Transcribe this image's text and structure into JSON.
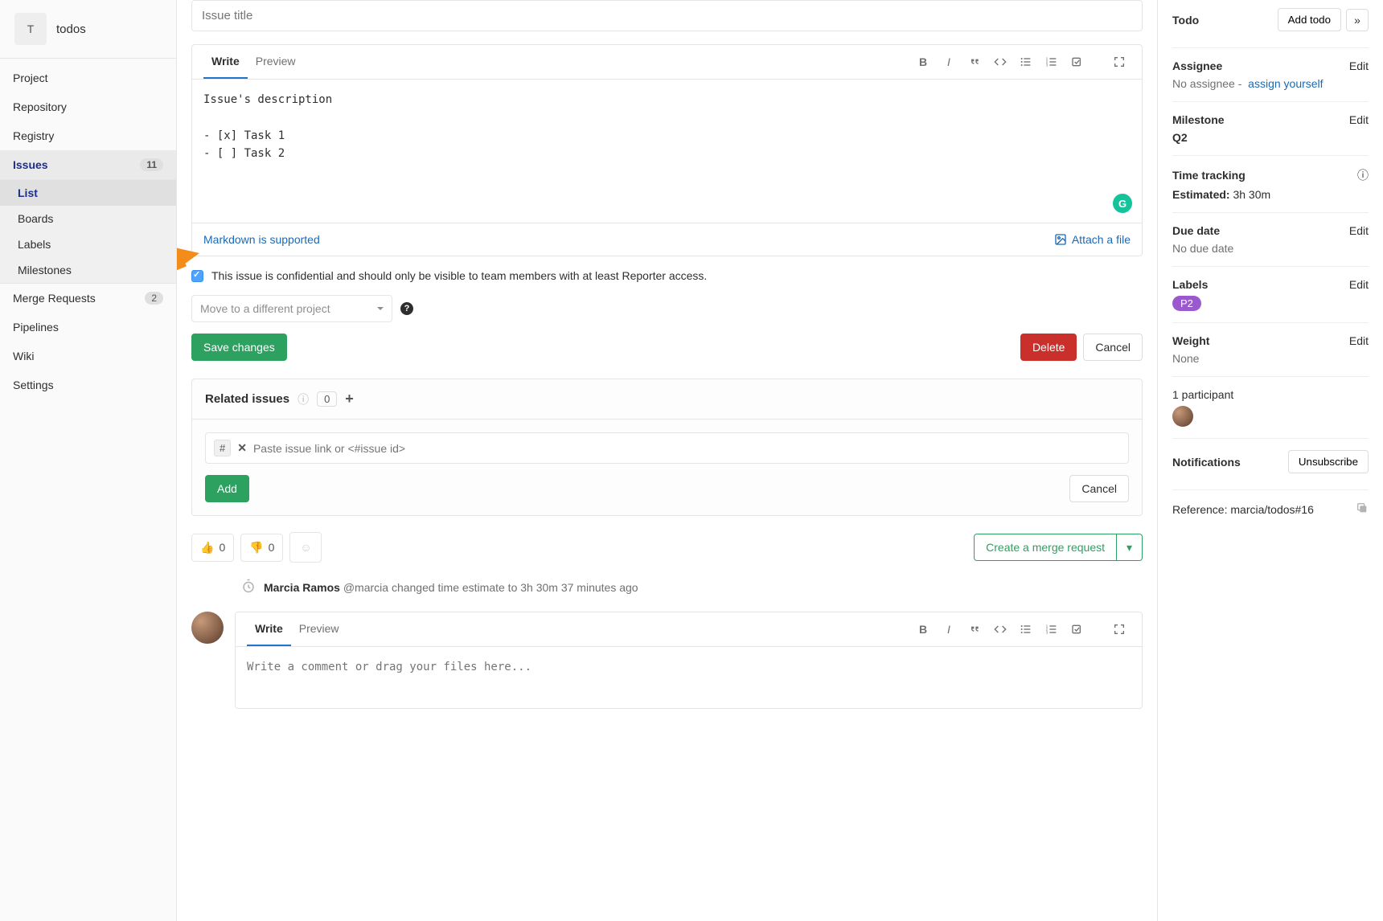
{
  "project": {
    "initial": "T",
    "name": "todos"
  },
  "sidebar": {
    "items": [
      {
        "label": "Project"
      },
      {
        "label": "Repository"
      },
      {
        "label": "Registry"
      },
      {
        "label": "Issues",
        "count": "11",
        "active": true,
        "children": [
          {
            "label": "List",
            "active": true
          },
          {
            "label": "Boards"
          },
          {
            "label": "Labels"
          },
          {
            "label": "Milestones"
          }
        ]
      },
      {
        "label": "Merge Requests",
        "count": "2"
      },
      {
        "label": "Pipelines"
      },
      {
        "label": "Wiki"
      },
      {
        "label": "Settings"
      }
    ]
  },
  "issue": {
    "title_placeholder": "Issue title",
    "tabs": {
      "write": "Write",
      "preview": "Preview"
    },
    "description": "Issue's description\n\n- [x] Task 1\n- [ ] Task 2",
    "markdown_link": "Markdown is supported",
    "attach_link": "Attach a file",
    "confidential_text": "This issue is confidential and should only be visible to team members with at least Reporter access.",
    "move_placeholder": "Move to a different project",
    "save_btn": "Save changes",
    "delete_btn": "Delete",
    "cancel_btn": "Cancel"
  },
  "related": {
    "heading": "Related issues",
    "count": "0",
    "tag": "#",
    "input_placeholder": "Paste issue link or <#issue id>",
    "add_btn": "Add",
    "cancel_btn": "Cancel"
  },
  "reactions": {
    "thumbs_up": "0",
    "thumbs_down": "0",
    "merge_btn": "Create a merge request"
  },
  "activity": {
    "author": "Marcia Ramos",
    "handle": "@marcia",
    "text": "changed time estimate to 3h 30m",
    "time": "37 minutes ago"
  },
  "comment": {
    "tabs": {
      "write": "Write",
      "preview": "Preview"
    },
    "placeholder": "Write a comment or drag your files here..."
  },
  "right": {
    "todo_label": "Todo",
    "add_todo": "Add todo",
    "assignee": {
      "title": "Assignee",
      "value": "No assignee -",
      "link": "assign yourself",
      "edit": "Edit"
    },
    "milestone": {
      "title": "Milestone",
      "value": "Q2",
      "edit": "Edit"
    },
    "time": {
      "title": "Time tracking",
      "est_label": "Estimated:",
      "est_value": "3h 30m"
    },
    "due": {
      "title": "Due date",
      "value": "No due date",
      "edit": "Edit"
    },
    "labels": {
      "title": "Labels",
      "pill": "P2",
      "edit": "Edit"
    },
    "weight": {
      "title": "Weight",
      "value": "None",
      "edit": "Edit"
    },
    "participants": "1 participant",
    "notifications": {
      "title": "Notifications",
      "btn": "Unsubscribe"
    },
    "reference": {
      "label": "Reference:",
      "value": "marcia/todos#16"
    }
  }
}
